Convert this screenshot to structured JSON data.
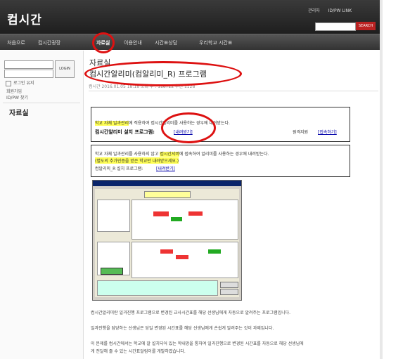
{
  "site": {
    "logo": "컴시간",
    "top_links": [
      "관리자",
      "ID/PW LINK"
    ],
    "search_button": "SEARCH"
  },
  "nav": {
    "items": [
      "처음으로",
      "컴시간광장",
      "자료실",
      "이용안내",
      "시간표상담",
      "우리학교 시간표"
    ],
    "active": "자료실"
  },
  "login": {
    "button": "LOGIN",
    "remember": "로그인 유지",
    "links": [
      "회원가입",
      "ID/PW 찾기"
    ]
  },
  "sidebar": {
    "title": "자료실"
  },
  "post": {
    "section": "자료실",
    "title": "컴시간알리미(컴알리미_R) 프로그램",
    "meta": "컴시간   2016.01.05 18:18   조회 수 : 118722   추천 1128"
  },
  "box1": {
    "line1_highlight": "학교 자체 일과관리",
    "line1_rest": "에 적용하여 컴시간알리미를 사용하는 경우에 내려받는다.",
    "install_label": "컴시간알리미 설치 프로그램:",
    "install_link": "[내려받기]",
    "right_label": "원격지원",
    "right_link": "[접속하기]"
  },
  "box2": {
    "line1_pre": "학교 자체 일과관리를 사용하지 않고 ",
    "line1_highlight": "컴시간서버",
    "line1_post": "에 접속하여 알리미를 사용하는 경우에 내려받는다.",
    "line2": "(별도의 추가인증을 받은 학교만 내려받으세요.)",
    "install_label": "컴알리미_R 설치 프로그램:",
    "install_link": "[내려받기]"
  },
  "body": {
    "p1": "컴시간알리미란 일과진행 프로그램으로 변경된 교사시간표를 해당 선생님에게 자동으로 알려주는 프로그램입니다.",
    "p2": "일과진행을 담당하는 선생님은 당일 변경된 시간표를 해당 선생님에게 손쉽게 알려주는 것이 과제입니다.",
    "p3a": "이 문제를 컴시간에서는 학교에 잘 설치되어 있는 학내망을 통하여 일과진행으로 변경된 시간표를 자동으로 해당 선생님에",
    "p3b": "게 전달해 줄 수 있는 시간표알림이를 개발하였습니다."
  },
  "colors": {
    "accent": "#b22222",
    "highlight": "#ffff55",
    "link": "#0000aa",
    "ring": "#dd1111"
  }
}
